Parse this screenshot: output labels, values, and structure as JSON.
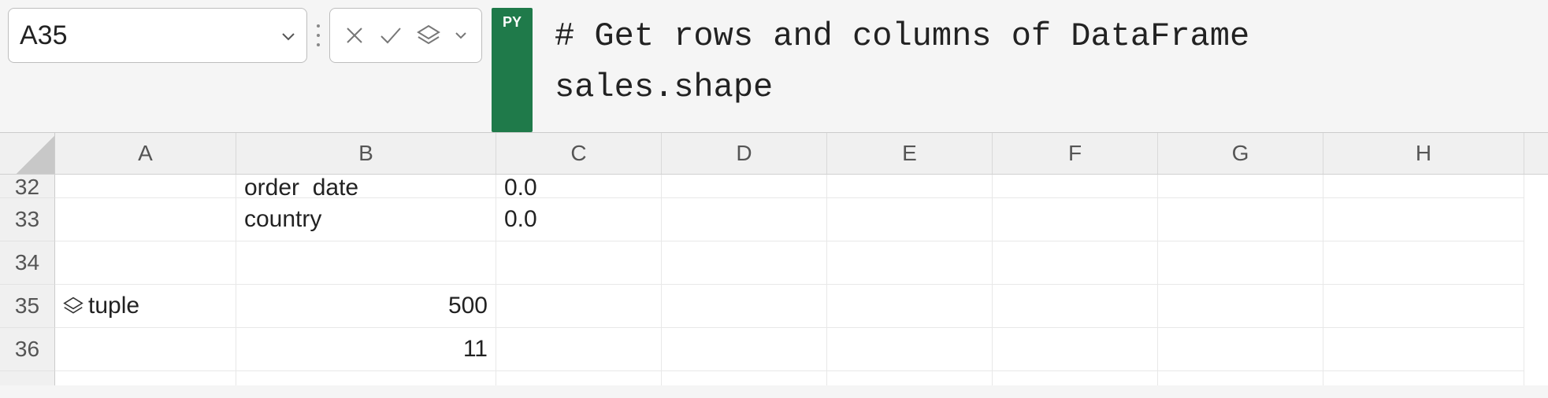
{
  "nameBox": {
    "value": "A35"
  },
  "pyBadge": "PY",
  "formula": {
    "line1": "# Get rows and columns of DataFrame",
    "line2": "sales.shape"
  },
  "columns": [
    "A",
    "B",
    "C",
    "D",
    "E",
    "F",
    "G",
    "H"
  ],
  "rows": [
    {
      "num": "32",
      "clipped": true,
      "A_text": "",
      "A_icon": false,
      "B_text": "order_date",
      "B_align": "left",
      "C_text": "0.0"
    },
    {
      "num": "33",
      "clipped": false,
      "A_text": "",
      "A_icon": false,
      "B_text": "country",
      "B_align": "left",
      "C_text": "0.0"
    },
    {
      "num": "34",
      "clipped": false,
      "A_text": "",
      "A_icon": false,
      "B_text": "",
      "B_align": "left",
      "C_text": ""
    },
    {
      "num": "35",
      "clipped": false,
      "A_text": "tuple",
      "A_icon": true,
      "B_text": "500",
      "B_align": "right",
      "C_text": ""
    },
    {
      "num": "36",
      "clipped": false,
      "A_text": "",
      "A_icon": false,
      "B_text": "11",
      "B_align": "right",
      "C_text": ""
    }
  ],
  "bottomRowPartial": "37"
}
